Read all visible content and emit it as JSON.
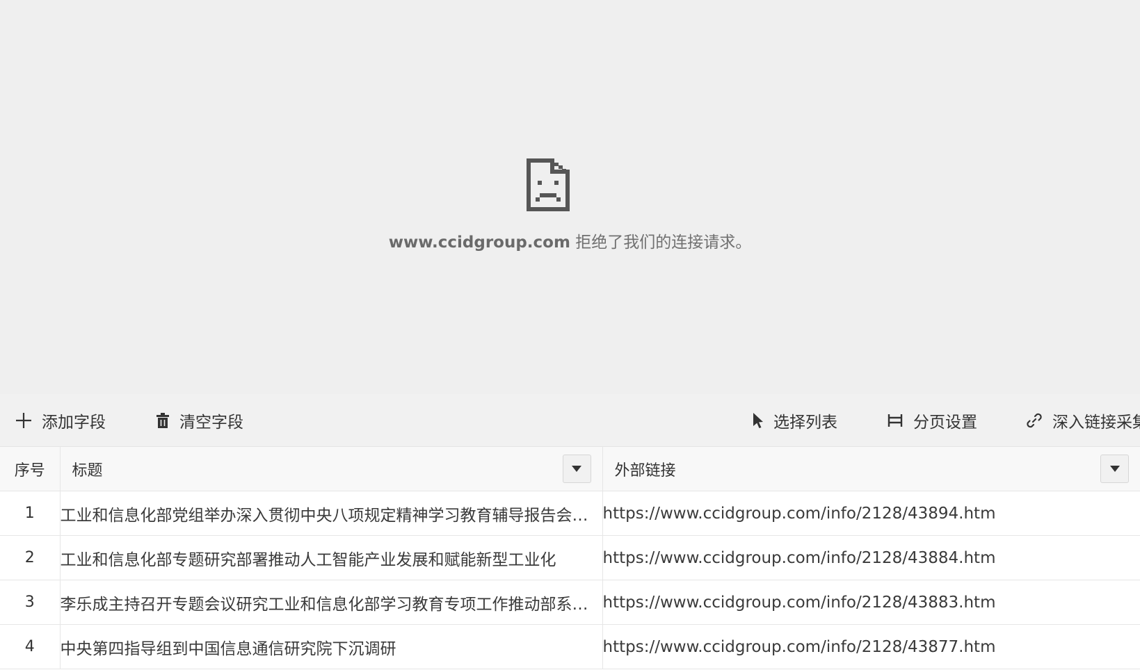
{
  "error_page": {
    "icon": "sad-document-icon",
    "host": "www.ccidgroup.com",
    "message": " 拒绝了我们的连接请求。"
  },
  "toolbar": {
    "add_field": "添加字段",
    "clear_fields": "清空字段",
    "select_list": "选择列表",
    "pagination_settings": "分页设置",
    "deep_link_crawl": "深入链接采集"
  },
  "table": {
    "headers": {
      "seq": "序号",
      "title": "标题",
      "link": "外部链接"
    },
    "rows": [
      {
        "seq": "1",
        "title": "工业和信息化部党组举办深入贯彻中央八项规定精神学习教育辅导报告会暨局处级干部读书班",
        "link": "https://www.ccidgroup.com/info/2128/43894.htm"
      },
      {
        "seq": "2",
        "title": "工业和信息化部专题研究部署推动人工智能产业发展和赋能新型工业化",
        "link": "https://www.ccidgroup.com/info/2128/43884.htm"
      },
      {
        "seq": "3",
        "title": "李乐成主持召开专题会议研究工业和信息化部学习教育专项工作推动部系统深入开展",
        "link": "https://www.ccidgroup.com/info/2128/43883.htm"
      },
      {
        "seq": "4",
        "title": "中央第四指导组到中国信息通信研究院下沉调研",
        "link": "https://www.ccidgroup.com/info/2128/43877.htm"
      }
    ]
  },
  "colors": {
    "error_background": "#efefef",
    "toolbar_background": "#f1f1f1",
    "text": "#333333"
  }
}
